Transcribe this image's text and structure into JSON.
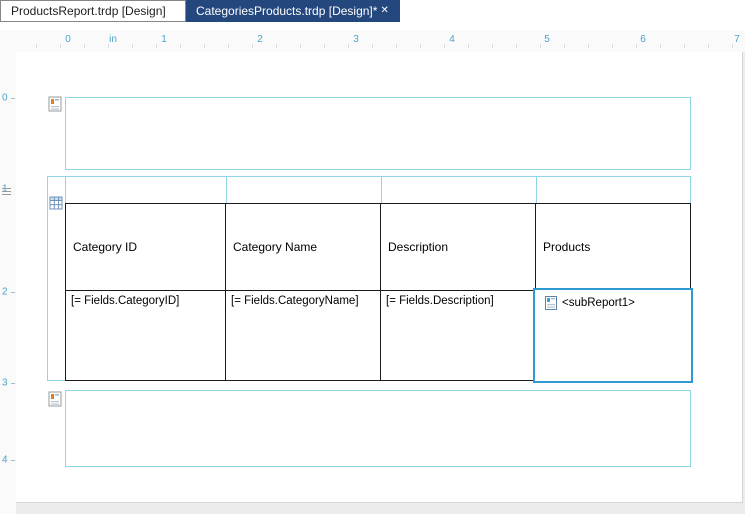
{
  "window": {
    "tabs": [
      {
        "label": "ProductsReport.trdp [Design]",
        "active": false
      },
      {
        "label": "CategoriesProducts.trdp [Design]*",
        "active": true,
        "close_icon": "✕"
      }
    ]
  },
  "ruler": {
    "h": [
      "0",
      "in",
      "1",
      "2",
      "3",
      "4",
      "5",
      "6",
      "7"
    ],
    "v": [
      "0",
      "1",
      "2",
      "3",
      "4"
    ]
  },
  "design": {
    "table": {
      "headers": [
        "Category ID",
        "Category Name",
        "Description",
        "Products"
      ],
      "detail_cells": [
        "[= Fields.CategoryID]",
        "[= Fields.CategoryName]",
        "[= Fields.Description]"
      ],
      "subreport_label": "<subReport1>"
    }
  },
  "colors": {
    "active_tab": "#24477e",
    "ruler_text": "#4aa4c8",
    "section_border": "#8ed5e6",
    "selection_border": "#2f9ad2"
  }
}
